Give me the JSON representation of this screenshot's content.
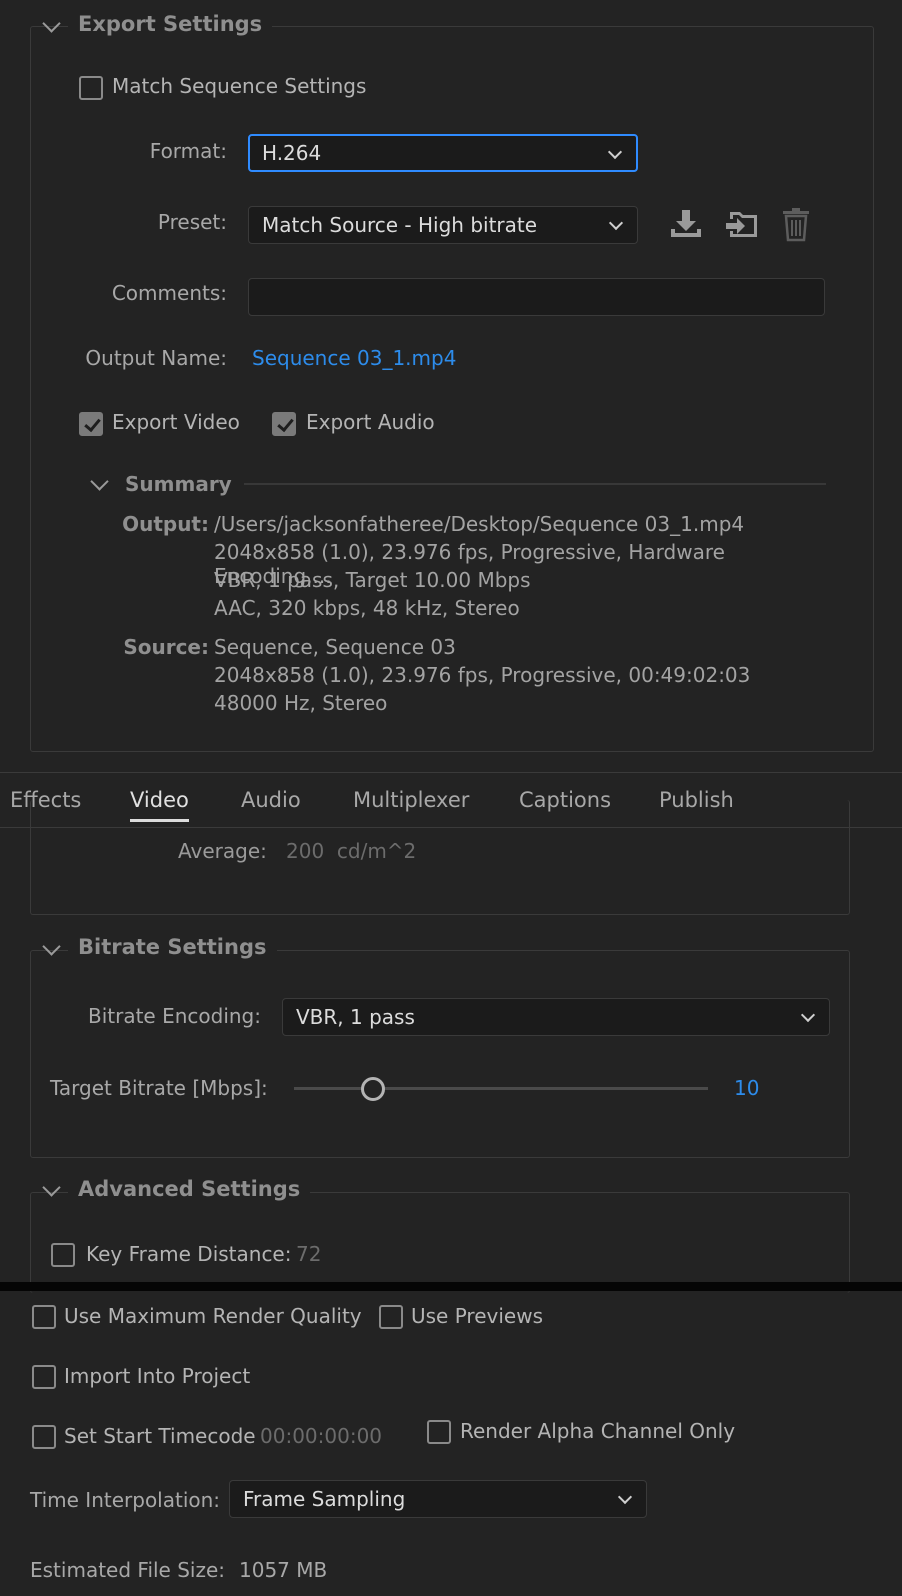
{
  "export_settings": {
    "title": "Export Settings",
    "match_sequence": {
      "label": "Match Sequence Settings",
      "checked": false
    },
    "format": {
      "label": "Format:",
      "value": "H.264"
    },
    "preset": {
      "label": "Preset:",
      "value": "Match Source - High bitrate"
    },
    "comments": {
      "label": "Comments:",
      "value": ""
    },
    "output_name": {
      "label": "Output Name:",
      "value": "Sequence 03_1.mp4"
    },
    "export_video": {
      "label": "Export Video",
      "checked": true
    },
    "export_audio": {
      "label": "Export Audio",
      "checked": true
    },
    "summary": {
      "title": "Summary",
      "output_label": "Output:",
      "output_lines": [
        "/Users/jacksonfatheree/Desktop/Sequence 03_1.mp4",
        "2048x858 (1.0), 23.976 fps, Progressive, Hardware Encoding,...",
        "VBR, 1 pass, Target 10.00 Mbps",
        "AAC, 320 kbps, 48 kHz, Stereo"
      ],
      "source_label": "Source:",
      "source_lines": [
        "Sequence, Sequence 03",
        "2048x858 (1.0), 23.976 fps, Progressive, 00:49:02:03",
        "48000 Hz, Stereo"
      ]
    }
  },
  "tabs": [
    {
      "label": "Effects",
      "active": false
    },
    {
      "label": "Video",
      "active": true
    },
    {
      "label": "Audio",
      "active": false
    },
    {
      "label": "Multiplexer",
      "active": false
    },
    {
      "label": "Captions",
      "active": false
    },
    {
      "label": "Publish",
      "active": false
    }
  ],
  "video": {
    "average_label": "Average:",
    "average_value": "200  cd/m^2",
    "bitrate": {
      "title": "Bitrate Settings",
      "encoding_label": "Bitrate Encoding:",
      "encoding_value": "VBR, 1 pass",
      "target_label": "Target Bitrate [Mbps]:",
      "target_value": "10",
      "target_fraction": 0.19
    },
    "advanced": {
      "title": "Advanced Settings",
      "key_frame_label": "Key Frame Distance:",
      "key_frame_value": "72",
      "key_frame_checked": false
    }
  },
  "bottom": {
    "max_render_quality": {
      "label": "Use Maximum Render Quality",
      "checked": false
    },
    "use_previews": {
      "label": "Use Previews",
      "checked": false
    },
    "import_into_project": {
      "label": "Import Into Project",
      "checked": false
    },
    "set_start_timecode": {
      "label": "Set Start Timecode",
      "checked": false,
      "value": "00:00:00:00"
    },
    "render_alpha": {
      "label": "Render Alpha Channel Only",
      "checked": false
    },
    "time_interpolation": {
      "label": "Time Interpolation:",
      "value": "Frame Sampling"
    },
    "estimated_size": {
      "label": "Estimated File Size:",
      "value": "1057 MB"
    }
  },
  "colors": {
    "accent": "#2f8bff",
    "link": "#2d8ceb",
    "background": "#232323"
  }
}
